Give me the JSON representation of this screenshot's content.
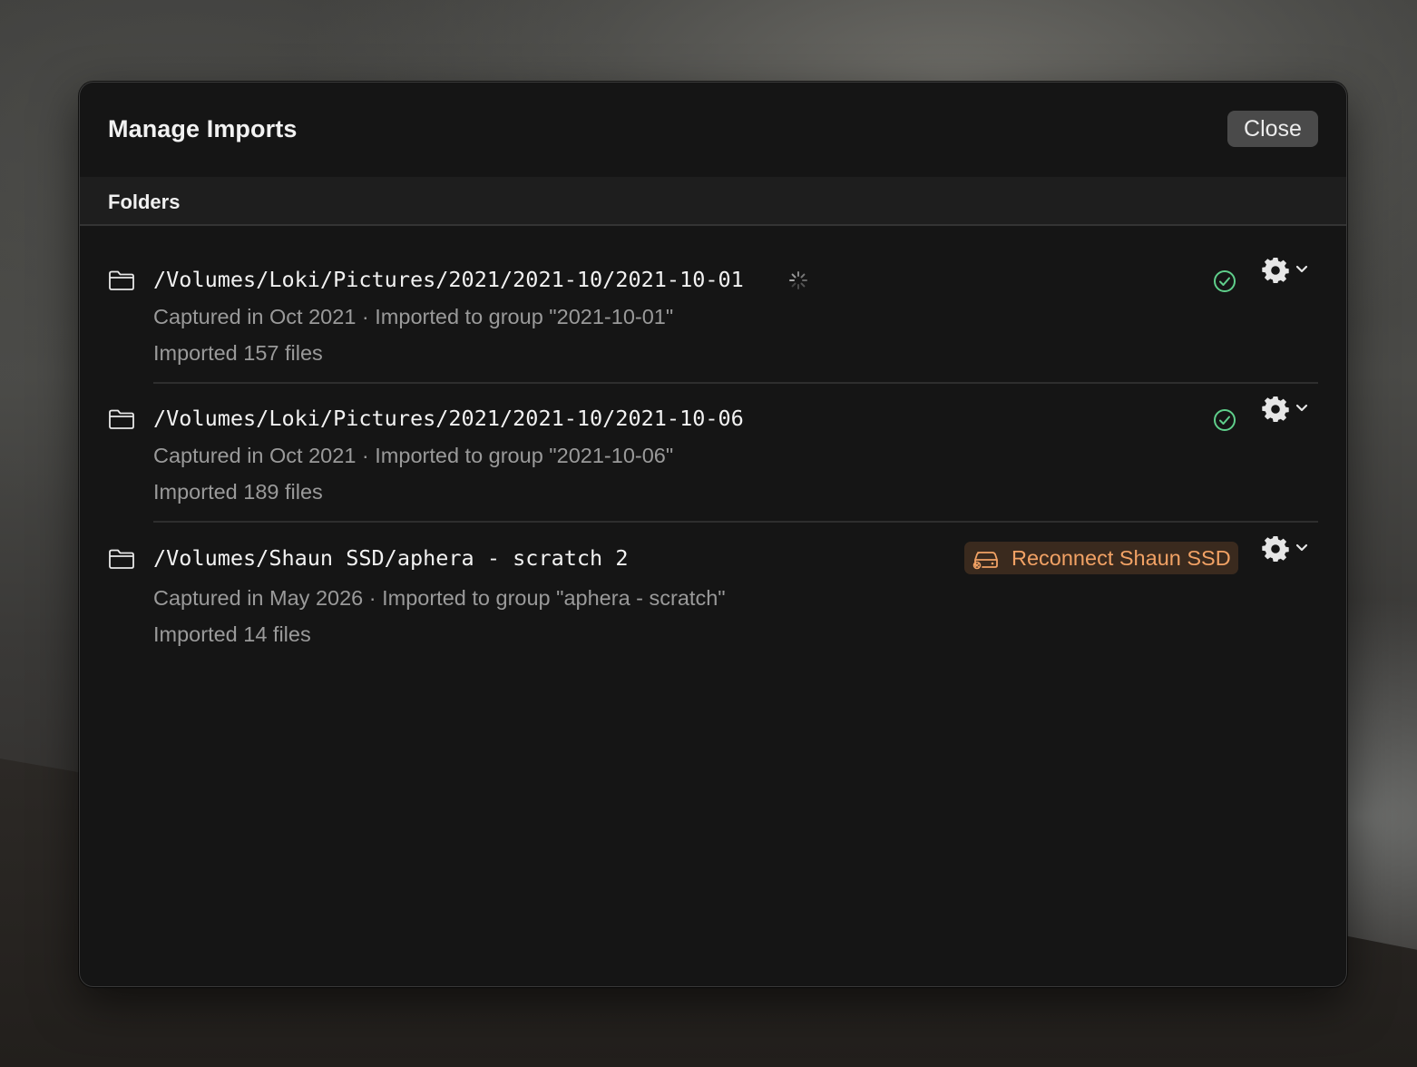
{
  "dialog": {
    "title": "Manage Imports",
    "close_label": "Close"
  },
  "section": {
    "title": "Folders"
  },
  "colors": {
    "success": "#5fcf8b",
    "warning": "#f2a265",
    "dialog_bg": "#151515"
  },
  "folders": [
    {
      "path": "/Volumes/Loki/Pictures/2021/2021-10/2021-10-01",
      "meta": "Captured in Oct 2021 · Imported to group \"2021-10-01\"",
      "count": "Imported 157 files",
      "status": "ok",
      "loading": true,
      "icons": [
        "folder-icon",
        "spinner-icon",
        "check-circle-icon",
        "gear-icon",
        "chevron-down-icon"
      ]
    },
    {
      "path": "/Volumes/Loki/Pictures/2021/2021-10/2021-10-06",
      "meta": "Captured in Oct 2021 · Imported to group \"2021-10-06\"",
      "count": "Imported 189 files",
      "status": "ok",
      "loading": false,
      "icons": [
        "folder-icon",
        "check-circle-icon",
        "gear-icon",
        "chevron-down-icon"
      ]
    },
    {
      "path": "/Volumes/Shaun SSD/aphera - scratch 2",
      "meta": "Captured in May 2026 · Imported to group \"aphera - scratch\"",
      "count": "Imported 14 files",
      "status": "disconnected",
      "reconnect_label": "Reconnect Shaun SSD",
      "loading": false,
      "icons": [
        "folder-icon",
        "external-drive-icon",
        "gear-icon",
        "chevron-down-icon"
      ]
    }
  ]
}
